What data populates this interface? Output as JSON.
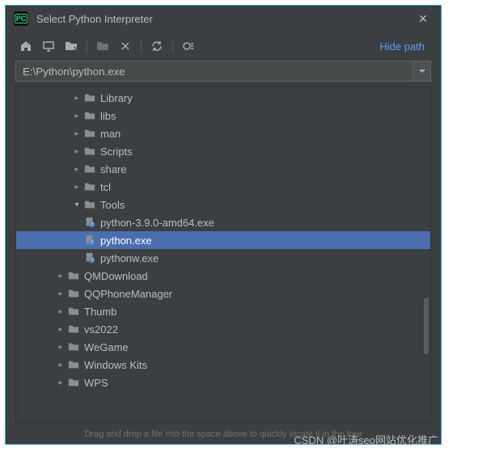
{
  "window": {
    "title": "Select Python Interpreter",
    "close": "✕"
  },
  "toolbar": {
    "hide_path": "Hide path"
  },
  "path_field": "E:\\Python\\python.exe",
  "tree": [
    {
      "indent": 3,
      "kind": "folder",
      "expandable": true,
      "name": "Library"
    },
    {
      "indent": 3,
      "kind": "folder",
      "expandable": true,
      "name": "libs"
    },
    {
      "indent": 3,
      "kind": "folder",
      "expandable": true,
      "name": "man"
    },
    {
      "indent": 3,
      "kind": "folder",
      "expandable": true,
      "name": "Scripts"
    },
    {
      "indent": 3,
      "kind": "folder",
      "expandable": true,
      "name": "share"
    },
    {
      "indent": 3,
      "kind": "folder",
      "expandable": true,
      "name": "tcl"
    },
    {
      "indent": 3,
      "kind": "folder",
      "expandable": true,
      "open": true,
      "name": "Tools"
    },
    {
      "indent": 3,
      "kind": "file",
      "expandable": false,
      "name": "python-3.9.0-amd64.exe"
    },
    {
      "indent": 3,
      "kind": "file",
      "expandable": false,
      "name": "python.exe",
      "selected": true
    },
    {
      "indent": 3,
      "kind": "file",
      "expandable": false,
      "name": "pythonw.exe"
    },
    {
      "indent": 2,
      "kind": "folder",
      "expandable": true,
      "name": "QMDownload"
    },
    {
      "indent": 2,
      "kind": "folder",
      "expandable": true,
      "name": "QQPhoneManager"
    },
    {
      "indent": 2,
      "kind": "folder",
      "expandable": true,
      "name": "Thumb"
    },
    {
      "indent": 2,
      "kind": "folder",
      "expandable": true,
      "name": "vs2022"
    },
    {
      "indent": 2,
      "kind": "folder",
      "expandable": true,
      "name": "WeGame"
    },
    {
      "indent": 2,
      "kind": "folder",
      "expandable": true,
      "name": "Windows Kits"
    },
    {
      "indent": 2,
      "kind": "folder",
      "expandable": true,
      "name": "WPS"
    }
  ],
  "hint": "Drag and drop a file into the space above to quickly locate it in the tree",
  "watermark": "CSDN @叶涛seo网站优化推广"
}
